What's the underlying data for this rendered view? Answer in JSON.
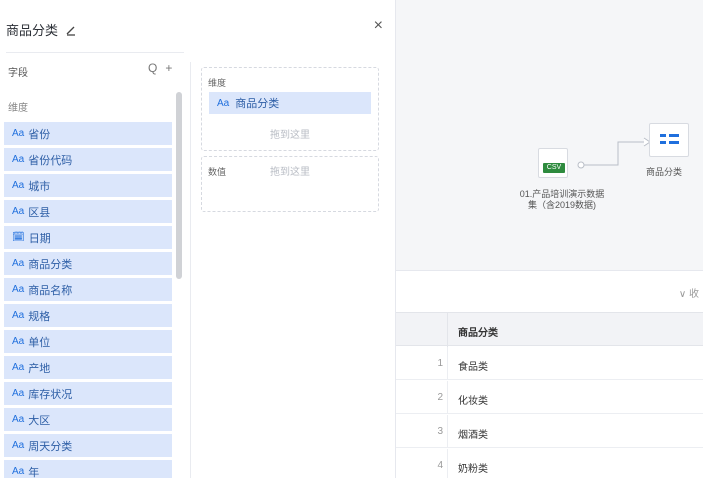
{
  "panel": {
    "title": "商品分类",
    "close_label": "×"
  },
  "fields": {
    "header": "字段",
    "search_icon": "Q",
    "add_icon": "+",
    "group_label": "维度",
    "items": [
      {
        "type": "Aa",
        "name": "省份"
      },
      {
        "type": "Aa",
        "name": "省份代码"
      },
      {
        "type": "Aa",
        "name": "城市"
      },
      {
        "type": "Aa",
        "name": "区县"
      },
      {
        "type": "date-icon",
        "name": "日期"
      },
      {
        "type": "Aa",
        "name": "商品分类"
      },
      {
        "type": "Aa",
        "name": "商品名称"
      },
      {
        "type": "Aa",
        "name": "规格"
      },
      {
        "type": "Aa",
        "name": "单位"
      },
      {
        "type": "Aa",
        "name": "产地"
      },
      {
        "type": "Aa",
        "name": "库存状况"
      },
      {
        "type": "Aa",
        "name": "大区"
      },
      {
        "type": "Aa",
        "name": "周天分类"
      },
      {
        "type": "Aa",
        "name": "年"
      }
    ]
  },
  "dimension_zone": {
    "label": "维度",
    "chip_type": "Aa",
    "chip_name": "商品分类",
    "hint": "拖到这里"
  },
  "value_zone": {
    "label": "数值",
    "hint": "拖到这里"
  },
  "canvas": {
    "csv_badge": "CSV",
    "csv_node_label_line1": "01.产品培训演示数据",
    "csv_node_label_line2": "集（含2019数据)",
    "filter_node_label": "商品分类"
  },
  "table": {
    "collapse_indicator": "∨ 收",
    "column_header": "商品分类",
    "rows": [
      {
        "index": "1",
        "value": "食品类"
      },
      {
        "index": "2",
        "value": "化妆类"
      },
      {
        "index": "3",
        "value": "烟酒类"
      },
      {
        "index": "4",
        "value": "奶粉类"
      }
    ]
  },
  "colors": {
    "accent": "#1f6fdd",
    "chip_bg": "#dbe6fb",
    "csv_green": "#2e8b3e",
    "canvas_bg": "#f5f6f8"
  }
}
